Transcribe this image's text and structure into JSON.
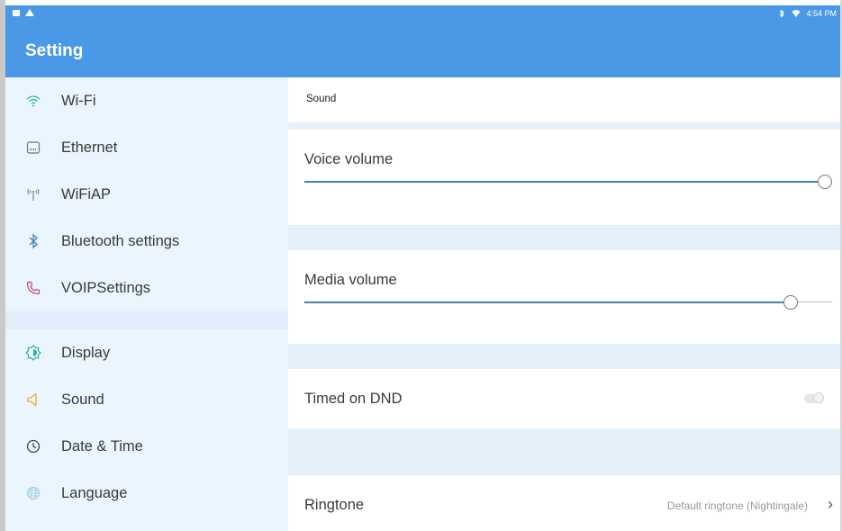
{
  "status_bar": {
    "time": "4:54 PM"
  },
  "app_bar": {
    "title": "Setting"
  },
  "sidebar": {
    "items": [
      {
        "label": "Wi-Fi",
        "icon": "wifi-icon",
        "color": "#2bb5a0"
      },
      {
        "label": "Ethernet",
        "icon": "ethernet-icon",
        "color": "#777777"
      },
      {
        "label": "WiFiAP",
        "icon": "hotspot-icon",
        "color": "#777777"
      },
      {
        "label": "Bluetooth settings",
        "icon": "bluetooth-icon",
        "color": "#4a7fb0"
      },
      {
        "label": "VOIPSettings",
        "icon": "phone-icon",
        "color": "#c0408a"
      },
      {
        "label": "Display",
        "icon": "display-icon",
        "color": "#2bb5a0"
      },
      {
        "label": "Sound",
        "icon": "speaker-icon",
        "color": "#e5b22a"
      },
      {
        "label": "Date & Time",
        "icon": "clock-icon",
        "color": "#444444"
      },
      {
        "label": "Language",
        "icon": "globe-icon",
        "color": "#a8cde8"
      }
    ]
  },
  "content": {
    "section_header": "Sound",
    "voice_volume": {
      "label": "Voice volume",
      "level": 1.0
    },
    "media_volume": {
      "label": "Media volume",
      "level": 0.94
    },
    "timed_dnd": {
      "label": "Timed on DND",
      "enabled": false
    },
    "ringtone": {
      "label": "Ringtone",
      "value": "Default ringtone (Nightingale)"
    }
  }
}
